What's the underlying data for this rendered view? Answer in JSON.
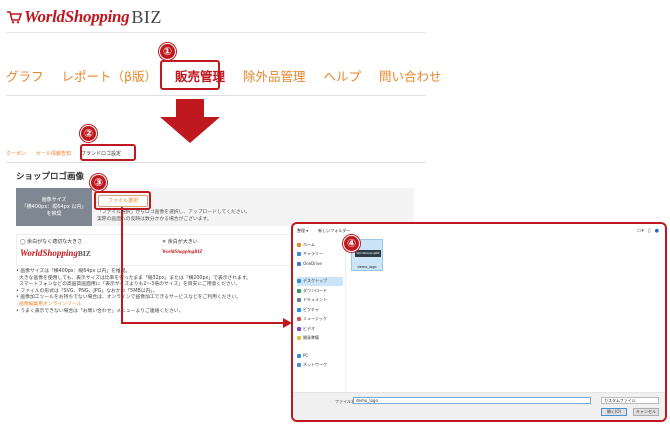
{
  "brand": {
    "logo_word": "WorldShopping",
    "logo_suffix": "BIZ",
    "accent": "#c0181f",
    "orange": "#e8862a"
  },
  "nav": {
    "items": [
      "グラフ",
      "レポート（β版）",
      "販売管理",
      "除外品管理",
      "ヘルプ",
      "問い合わせ"
    ],
    "active_index": 2
  },
  "steps": [
    "①",
    "②",
    "③",
    "④"
  ],
  "subtabs": [
    "クーポン",
    "セール情報告知",
    "ブランドロゴ設定"
  ],
  "section": {
    "title": "ショップロゴ画像"
  },
  "image_size": {
    "line1": "画像サイズ",
    "line2": "「横400px：縦64px 以内」",
    "line3": "を推奨"
  },
  "file_select": {
    "label": "ファイル選択"
  },
  "panel_text": [
    "「ファイル選択」からロゴ画像を選択し、アップロードしてください。",
    "実際の画面への反映は数分かかる場合がございます。"
  ],
  "examples": {
    "good": "◯ 余白がなく適切な大きさ",
    "bad": "✕ 余白が大きい"
  },
  "notes": [
    "画像サイズは「横400px：縦64px 以内」を推奨。",
    "大きな画像を使用しても、表示サイズは比率を保ったまま「縦32px」または「横200px」で表示されます。",
    "スマートフォンなどの高画質画面用に「表示サイズよりも2〜3倍のサイズ」を目安にご用意ください。",
    "ファイルの形式は「SVG、PNG、JPG」なおかつ「5MB以内」。",
    "画像加工ツールをお持ちでない場合は、オンラインで画像加工できるサービスなどをご利用ください。",
    "画像編集用オンラインツール",
    "うまく表示できない場合は「お問い合わせ」メニューよりご連絡ください。"
  ],
  "dialog": {
    "toolbar": [
      "整理 ▾",
      "新しいフォルダー"
    ],
    "sidebar": [
      "ホーム",
      "ギャラリー",
      "OneDrive",
      "デスクトップ",
      "ダウンロード",
      "ドキュメント",
      "ピクチャ",
      "ミュージック",
      "ビデオ",
      "開発準備",
      "PC",
      "ネットワーク"
    ],
    "selected_sidebar_index": 3,
    "file": {
      "name": "demo_logo",
      "thumb_text": "WorldShoppingBIZ"
    },
    "filename_label": "ファイル名(N):",
    "filename_value": "demo_logo",
    "filetype": "カスタムファイル",
    "open_label": "開く(O)",
    "cancel_label": "キャンセル"
  }
}
